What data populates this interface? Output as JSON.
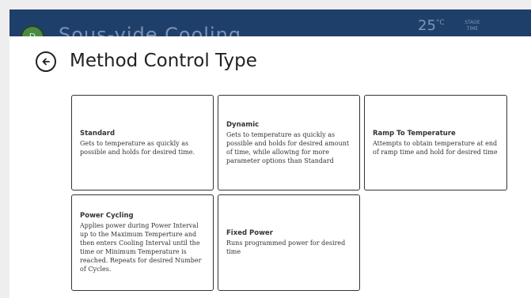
{
  "header": {
    "logo_text": "D",
    "app_title": "Sous-vide Cooling",
    "temperature": "25",
    "temperature_unit": "°C",
    "stage_label_1": "STAGE",
    "stage_label_2": "TIME"
  },
  "page": {
    "title": "Method Control Type"
  },
  "cards": [
    {
      "title": "Standard",
      "description": "Gets to temperature as quickly as possible and holds for desired time."
    },
    {
      "title": "Dynamic",
      "description": "Gets to temperature as quickly as possible and holds for desired amount of time, while allowing for more parameter options than Standard"
    },
    {
      "title": "Ramp To Temperature",
      "description": "Attempts to obtain temperature at end of ramp time and hold for desired time"
    },
    {
      "title": "Power Cycling",
      "description": "Applies power during Power Interval up to the Maximum Temperture and then enters Cooling Interval until the time or Minimum Temperature is reached. Repeats for desired Number of Cycles."
    },
    {
      "title": "Fixed Power",
      "description": "Runs programmed power for desired time"
    }
  ]
}
